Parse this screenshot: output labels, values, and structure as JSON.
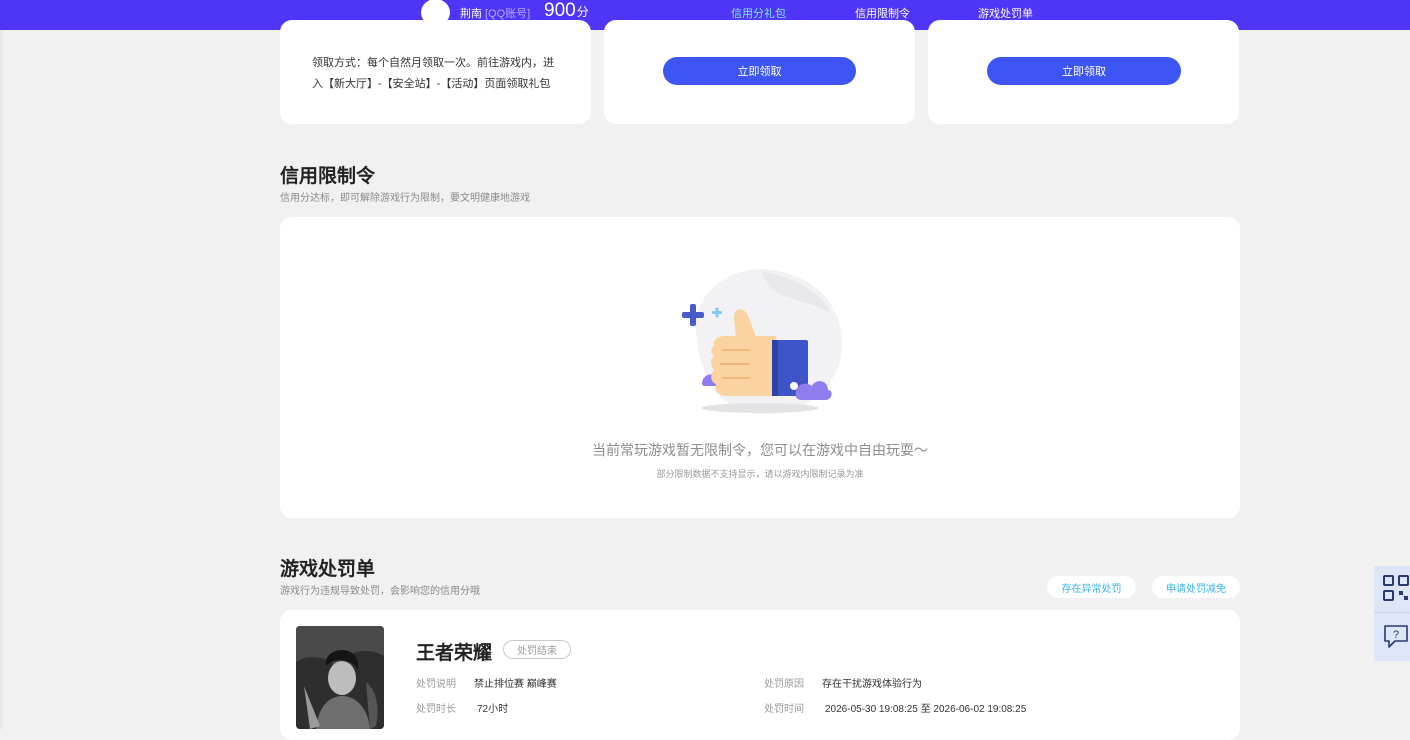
{
  "nav": {
    "user_name": "荆南",
    "account_type": "[QQ账号]",
    "score": "900",
    "score_unit": "分",
    "tabs": [
      {
        "label": "信用分礼包",
        "active": true
      },
      {
        "label": "信用限制令",
        "active": false
      },
      {
        "label": "游戏处罚单",
        "active": false
      }
    ]
  },
  "gift": {
    "claim_note": "领取方式：每个自然月领取一次。前往游戏内，进入【新大厅】-【安全站】-【活动】页面领取礼包",
    "claim_button": "立即领取"
  },
  "restriction": {
    "title": "信用限制令",
    "subtitle": "信用分达标，即可解除游戏行为限制，要文明健康地游戏",
    "empty_message": "当前常玩游戏暂无限制令，您可以在游戏中自由玩耍～",
    "empty_note": "部分限制数据不支持显示，请以游戏内限制记录为准"
  },
  "penalty": {
    "title": "游戏处罚单",
    "subtitle": "游戏行为违规导致处罚，会影响您的信用分哦",
    "abnormal_button": "存在异常处罚",
    "appeal_button": "申请处罚减免",
    "record": {
      "game": "王者荣耀",
      "status": "处罚结束",
      "desc_label": "处罚说明",
      "desc_value": "禁止排位赛 巅峰赛",
      "duration_label": "处罚时长",
      "duration_value": "72小时",
      "reason_label": "处罚原因",
      "reason_value": "存在干扰游戏体验行为",
      "time_label": "处罚时间",
      "time_value": "2026-05-30 19:08:25 至 2026-06-02 19:08:25"
    }
  },
  "colors": {
    "nav_bg": "#4f35f5",
    "button_blue": "#3d55f5",
    "active_tab": "#7fe8ff",
    "link_cyan": "#38b4e8"
  }
}
